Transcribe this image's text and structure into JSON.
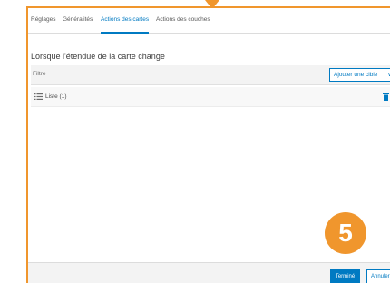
{
  "tabs": [
    {
      "label": "Réglages"
    },
    {
      "label": "Généralités"
    },
    {
      "label": "Actions des cartes"
    },
    {
      "label": "Actions des couches"
    }
  ],
  "active_tab": "Actions des cartes",
  "section": {
    "title": "Lorsque l'étendue de la carte change",
    "filter_label": "Filtre",
    "add_target_label": "Ajouter une cible"
  },
  "list": {
    "items": [
      {
        "label": "Liste (1)",
        "icon": "list-icon",
        "action_icon": "trash-icon"
      }
    ]
  },
  "callout": {
    "step_number": "5"
  },
  "footer": {
    "done_label": "Terminé",
    "cancel_label": "Annuler"
  },
  "colors": {
    "accent": "#007ac2",
    "highlight": "#f0962d",
    "footer_bg": "#f3f3f3"
  }
}
